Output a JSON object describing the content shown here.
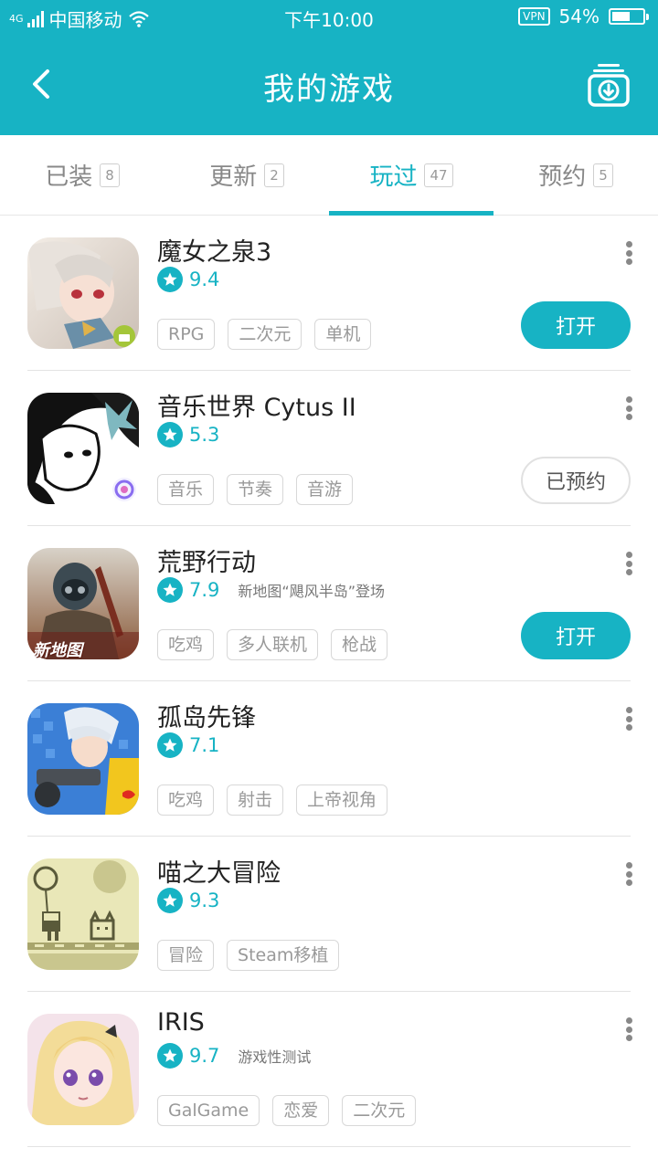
{
  "status_bar": {
    "network": "4G",
    "carrier": "中国移动",
    "time": "下午10:00",
    "vpn": "VPN",
    "battery_text": "54%",
    "battery_level": 0.54
  },
  "navbar": {
    "title": "我的游戏"
  },
  "tabs": [
    {
      "label": "已装",
      "count": "8"
    },
    {
      "label": "更新",
      "count": "2"
    },
    {
      "label": "玩过",
      "count": "47"
    },
    {
      "label": "预约",
      "count": "5"
    }
  ],
  "games": [
    {
      "name": "魔女之泉3",
      "score": "9.4",
      "note": "",
      "tags": [
        "RPG",
        "二次元",
        "单机"
      ],
      "button": "打开"
    },
    {
      "name": "音乐世界 Cytus II",
      "score": "5.3",
      "note": "",
      "tags": [
        "音乐",
        "节奏",
        "音游"
      ],
      "button": "已预约"
    },
    {
      "name": "荒野行动",
      "score": "7.9",
      "note": "新地图“飓风半岛”登场",
      "tags": [
        "吃鸡",
        "多人联机",
        "枪战"
      ],
      "button": "打开"
    },
    {
      "name": "孤岛先锋",
      "score": "7.1",
      "note": "",
      "tags": [
        "吃鸡",
        "射击",
        "上帝视角"
      ],
      "button": ""
    },
    {
      "name": "喵之大冒险",
      "score": "9.3",
      "note": "",
      "tags": [
        "冒险",
        "Steam移植"
      ],
      "button": ""
    },
    {
      "name": "IRIS",
      "score": "9.7",
      "note": "游戏性测试",
      "tags": [
        "GalGame",
        "恋爱",
        "二次元"
      ],
      "button": ""
    }
  ],
  "icon_badges": {
    "game_3": "新地图"
  },
  "colors": {
    "accent": "#17b3c4"
  }
}
